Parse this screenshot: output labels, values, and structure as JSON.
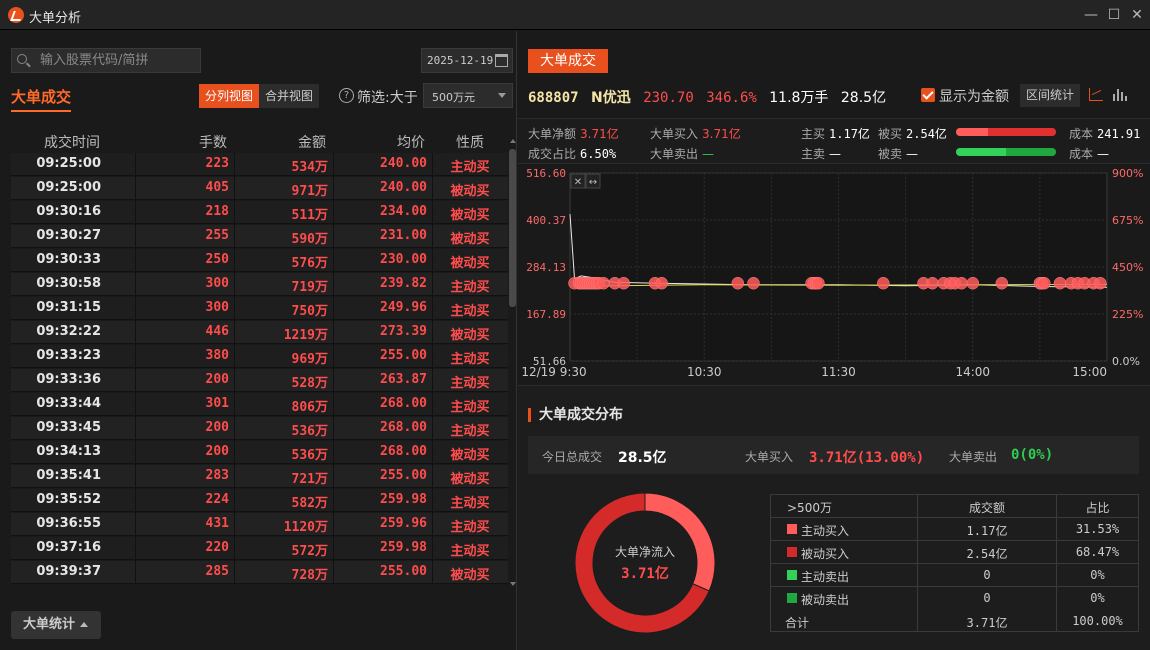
{
  "window": {
    "title": "大单分析",
    "minimize": "—",
    "maximize": "☐",
    "close": "✕"
  },
  "left": {
    "search_placeholder": "输入股票代码/简拼",
    "date": "2025-12-19",
    "title": "大单成交",
    "view_split": "分列视图",
    "view_merge": "合并视图",
    "filter_help": "?",
    "filter_label": "筛选:大于",
    "filter_value": "500万元",
    "columns": [
      "成交时间",
      "手数",
      "金额",
      "均价",
      "性质"
    ],
    "rows": [
      [
        "09:25:00",
        "223",
        "534万",
        "240.00",
        "主动买"
      ],
      [
        "09:25:00",
        "405",
        "971万",
        "240.00",
        "被动买"
      ],
      [
        "09:30:16",
        "218",
        "511万",
        "234.00",
        "被动买"
      ],
      [
        "09:30:27",
        "255",
        "590万",
        "231.00",
        "被动买"
      ],
      [
        "09:30:33",
        "250",
        "576万",
        "230.00",
        "被动买"
      ],
      [
        "09:30:58",
        "300",
        "719万",
        "239.82",
        "主动买"
      ],
      [
        "09:31:15",
        "300",
        "750万",
        "249.96",
        "主动买"
      ],
      [
        "09:32:22",
        "446",
        "1219万",
        "273.39",
        "被动买"
      ],
      [
        "09:33:23",
        "380",
        "969万",
        "255.00",
        "主动买"
      ],
      [
        "09:33:36",
        "200",
        "528万",
        "263.87",
        "主动买"
      ],
      [
        "09:33:44",
        "301",
        "806万",
        "268.00",
        "主动买"
      ],
      [
        "09:33:45",
        "200",
        "536万",
        "268.00",
        "主动买"
      ],
      [
        "09:34:13",
        "200",
        "536万",
        "268.00",
        "被动买"
      ],
      [
        "09:35:41",
        "283",
        "721万",
        "255.00",
        "被动买"
      ],
      [
        "09:35:52",
        "224",
        "582万",
        "259.98",
        "主动买"
      ],
      [
        "09:36:55",
        "431",
        "1120万",
        "259.96",
        "主动买"
      ],
      [
        "09:37:16",
        "220",
        "572万",
        "259.98",
        "主动买"
      ],
      [
        "09:39:37",
        "285",
        "728万",
        "255.00",
        "被动买"
      ]
    ],
    "stats_button": "大单统计"
  },
  "right": {
    "tab": "大单成交",
    "quote": {
      "code": "688807",
      "name": "N优迅",
      "price": "230.70",
      "change_pct": "346.6%",
      "volume": "11.8万手",
      "turnover": "28.5亿"
    },
    "show_amount_label": "显示为金额",
    "range_stats_label": "区间统计",
    "info": {
      "net_label": "大单净额",
      "net_value": "3.71亿",
      "ratio_label": "成交占比",
      "ratio_value": "6.50%",
      "buy_label": "大单买入",
      "buy_value": "3.71亿",
      "sell_label": "大单卖出",
      "sell_value": "—",
      "active_buy_label": "主买",
      "active_buy_value": "1.17亿",
      "passive_buy_label": "被买",
      "passive_buy_value": "2.54亿",
      "active_sell_label": "主卖",
      "active_sell_value": "—",
      "passive_sell_label": "被卖",
      "passive_sell_value": "—",
      "cost_label": "成本",
      "cost_buy_value": "241.91",
      "cost_sell_value": "—",
      "buy_bar_active_share": 0.3153,
      "sell_bar_active_share": 0.5
    },
    "distribution": {
      "title": "大单成交分布",
      "total_label": "今日总成交",
      "total_value": "28.5亿",
      "buy_label": "大单买入",
      "buy_value": "3.71亿(13.00%)",
      "sell_label": "大单卖出",
      "sell_value": "0(0%)",
      "donut_label": "大单净流入",
      "donut_value": "3.71亿",
      "donut_shares": [
        0.3153,
        0.6847
      ],
      "table_header": [
        ">500万",
        "成交额",
        "占比"
      ],
      "table_rows": [
        {
          "label": "主动买入",
          "amount": "1.17亿",
          "pct": "31.53%",
          "color": "#ff5c5c"
        },
        {
          "label": "被动买入",
          "amount": "2.54亿",
          "pct": "68.47%",
          "color": "#d42a2a"
        },
        {
          "label": "主动卖出",
          "amount": "0",
          "pct": "0%",
          "color": "#33d15a"
        },
        {
          "label": "被动卖出",
          "amount": "0",
          "pct": "0%",
          "color": "#1fa83f"
        }
      ],
      "table_total": {
        "label": "合计",
        "amount": "3.71亿",
        "pct": "100.00%"
      }
    }
  },
  "chart_data": {
    "type": "line",
    "title": "",
    "y_left_ticks": [
      "516.60",
      "400.37",
      "284.13",
      "167.89",
      "51.66"
    ],
    "y_left_values": [
      516.6,
      400.37,
      284.13,
      167.89,
      51.66
    ],
    "y_right_ticks": [
      "900%",
      "675%",
      "450%",
      "225%",
      "0.0%"
    ],
    "x_ticks": [
      "12/19 9:30",
      "10:30",
      "11:30",
      "14:00",
      "15:00"
    ],
    "ylim": [
      51.66,
      516.6
    ],
    "x_domain_minutes": [
      0,
      240
    ],
    "price_series": [
      {
        "t": 0,
        "v": 415
      },
      {
        "t": 2,
        "v": 255
      },
      {
        "t": 5,
        "v": 262
      },
      {
        "t": 10,
        "v": 258
      },
      {
        "t": 20,
        "v": 246
      },
      {
        "t": 40,
        "v": 244
      },
      {
        "t": 60,
        "v": 242
      },
      {
        "t": 80,
        "v": 240
      },
      {
        "t": 100,
        "v": 240
      },
      {
        "t": 120,
        "v": 240
      },
      {
        "t": 150,
        "v": 238
      },
      {
        "t": 180,
        "v": 240
      },
      {
        "t": 210,
        "v": 236
      },
      {
        "t": 240,
        "v": 234
      }
    ],
    "avg_series": [
      {
        "t": 2,
        "v": 236
      },
      {
        "t": 20,
        "v": 238
      },
      {
        "t": 60,
        "v": 240
      },
      {
        "t": 120,
        "v": 239
      },
      {
        "t": 180,
        "v": 240
      },
      {
        "t": 240,
        "v": 241
      }
    ],
    "trade_points_minutes": [
      2,
      4,
      5,
      6,
      7,
      8,
      9,
      10,
      11,
      12,
      13,
      15,
      20,
      24,
      38,
      41,
      75,
      82,
      108,
      109,
      110,
      111,
      140,
      158,
      162,
      167,
      170,
      172,
      175,
      180,
      193,
      210,
      211,
      212,
      219,
      224,
      227,
      230,
      234,
      237
    ],
    "trade_points_value": 244
  }
}
